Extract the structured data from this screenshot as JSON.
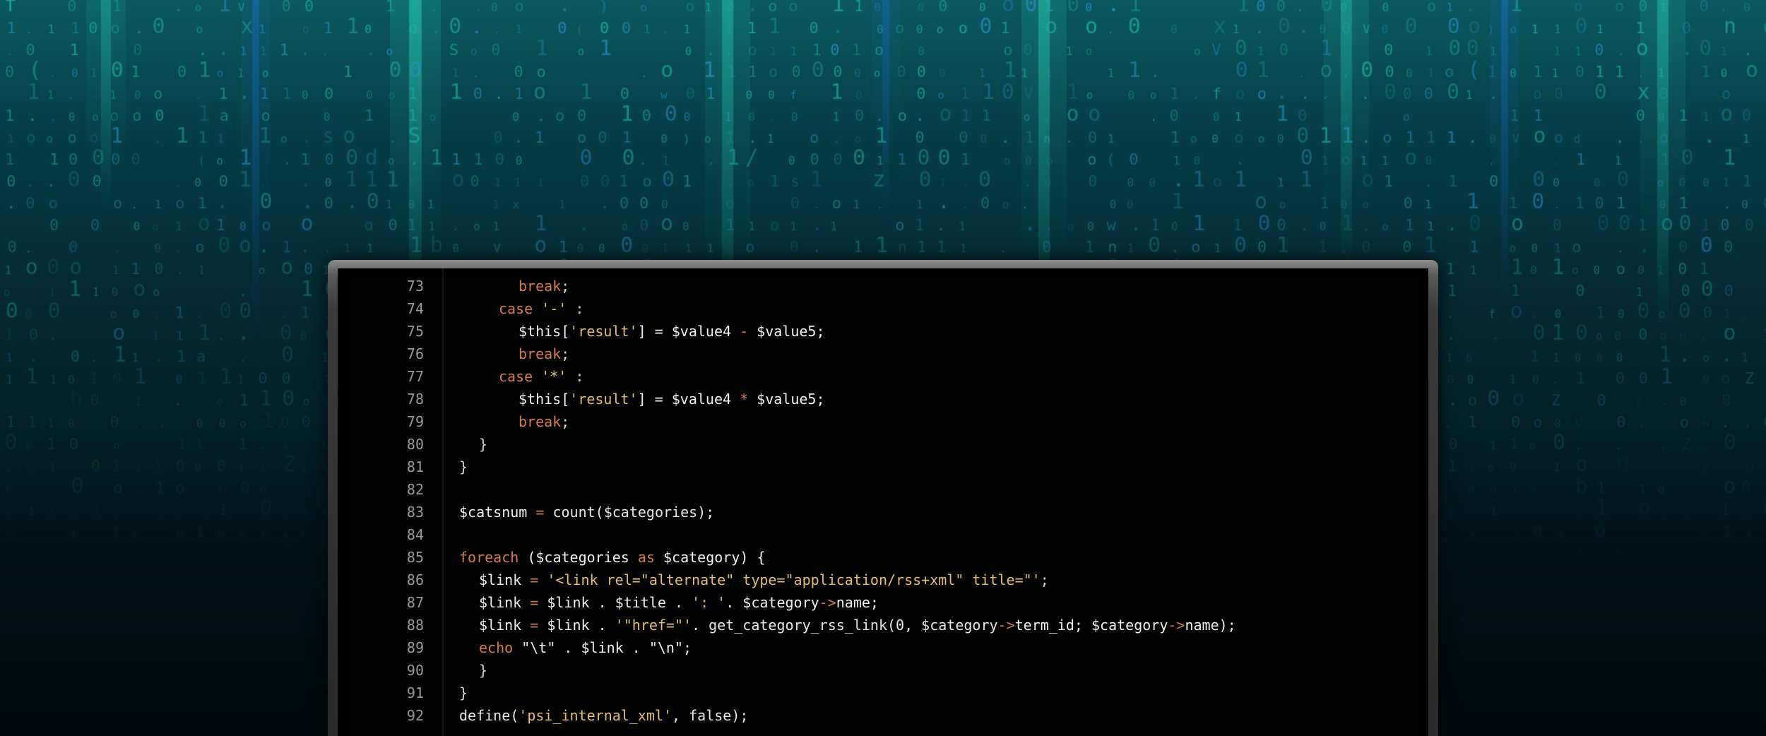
{
  "scene": {
    "background": "matrix-style falling binary code",
    "colors": {
      "teal_glow": "#19c3a6",
      "blue_glow": "#1b7fd6",
      "digit_teal": "#2ab3a8",
      "code_bg": "#020202",
      "line_number": "#9a9a9a",
      "keyword": "#d47c4a",
      "string": "#e2bd72",
      "operator": "#cc7a52",
      "text": "#e6e6e6"
    }
  },
  "editor": {
    "lines": [
      {
        "num": "73",
        "indent": 3,
        "tokens": [
          {
            "t": "break",
            "c": "kw"
          },
          {
            "t": ";",
            "c": "punc"
          }
        ]
      },
      {
        "num": "74",
        "indent": 2,
        "tokens": [
          {
            "t": "case",
            "c": "kw"
          },
          {
            "t": " ",
            "c": "punc"
          },
          {
            "t": "'-'",
            "c": "str"
          },
          {
            "t": " :",
            "c": "punc"
          }
        ]
      },
      {
        "num": "75",
        "indent": 3,
        "tokens": [
          {
            "t": "$this[",
            "c": "var"
          },
          {
            "t": "'result'",
            "c": "str"
          },
          {
            "t": "] = $value4 ",
            "c": "var"
          },
          {
            "t": "-",
            "c": "op"
          },
          {
            "t": " $value5;",
            "c": "var"
          }
        ]
      },
      {
        "num": "76",
        "indent": 3,
        "tokens": [
          {
            "t": "break",
            "c": "kw"
          },
          {
            "t": ";",
            "c": "punc"
          }
        ]
      },
      {
        "num": "77",
        "indent": 2,
        "tokens": [
          {
            "t": "case",
            "c": "kw"
          },
          {
            "t": " ",
            "c": "punc"
          },
          {
            "t": "'*'",
            "c": "str"
          },
          {
            "t": " :",
            "c": "punc"
          }
        ]
      },
      {
        "num": "78",
        "indent": 3,
        "tokens": [
          {
            "t": "$this[",
            "c": "var"
          },
          {
            "t": "'result'",
            "c": "str"
          },
          {
            "t": "] = $value4 ",
            "c": "var"
          },
          {
            "t": "*",
            "c": "op"
          },
          {
            "t": " $value5;",
            "c": "var"
          }
        ]
      },
      {
        "num": "79",
        "indent": 3,
        "tokens": [
          {
            "t": "break",
            "c": "kw"
          },
          {
            "t": ";",
            "c": "punc"
          }
        ]
      },
      {
        "num": "80",
        "indent": 1,
        "tokens": [
          {
            "t": "}",
            "c": "punc"
          }
        ]
      },
      {
        "num": "81",
        "indent": 0,
        "tokens": [
          {
            "t": "}",
            "c": "punc"
          }
        ]
      },
      {
        "num": "82",
        "indent": 0,
        "tokens": []
      },
      {
        "num": "83",
        "indent": 0,
        "tokens": [
          {
            "t": "$catsnum ",
            "c": "var"
          },
          {
            "t": "=",
            "c": "op"
          },
          {
            "t": " count($categories);",
            "c": "fn"
          }
        ]
      },
      {
        "num": "84",
        "indent": 0,
        "tokens": []
      },
      {
        "num": "85",
        "indent": 0,
        "tokens": [
          {
            "t": "foreach",
            "c": "kw"
          },
          {
            "t": " ($categories ",
            "c": "var"
          },
          {
            "t": "as",
            "c": "kw"
          },
          {
            "t": " $category) {",
            "c": "var"
          }
        ]
      },
      {
        "num": "86",
        "indent": 1,
        "tokens": [
          {
            "t": "$link ",
            "c": "var"
          },
          {
            "t": "=",
            "c": "op"
          },
          {
            "t": " ",
            "c": "punc"
          },
          {
            "t": "'<link rel=\"alternate\" type=\"application/rss+xml\" title=\"'",
            "c": "str"
          },
          {
            "t": ";",
            "c": "punc"
          }
        ]
      },
      {
        "num": "87",
        "indent": 1,
        "tokens": [
          {
            "t": "$link ",
            "c": "var"
          },
          {
            "t": "=",
            "c": "op"
          },
          {
            "t": " $link . $title . ",
            "c": "var"
          },
          {
            "t": "': '",
            "c": "str"
          },
          {
            "t": ". $category",
            "c": "var"
          },
          {
            "t": "->",
            "c": "op"
          },
          {
            "t": "name;",
            "c": "var"
          }
        ]
      },
      {
        "num": "88",
        "indent": 1,
        "tokens": [
          {
            "t": "$link ",
            "c": "var"
          },
          {
            "t": "=",
            "c": "op"
          },
          {
            "t": " $link . ",
            "c": "var"
          },
          {
            "t": "'\"href=\"'",
            "c": "str"
          },
          {
            "t": ". get_category_rss_link(0, $category",
            "c": "fn"
          },
          {
            "t": "->",
            "c": "op"
          },
          {
            "t": "term_id; $category",
            "c": "var"
          },
          {
            "t": "->",
            "c": "op"
          },
          {
            "t": "name);",
            "c": "var"
          }
        ]
      },
      {
        "num": "89",
        "indent": 1,
        "tokens": [
          {
            "t": "echo",
            "c": "kw"
          },
          {
            "t": " \"\\t\" . $link . \"\\n\";",
            "c": "var"
          }
        ]
      },
      {
        "num": "90",
        "indent": 1,
        "tokens": [
          {
            "t": "}",
            "c": "punc"
          }
        ]
      },
      {
        "num": "91",
        "indent": 0,
        "tokens": [
          {
            "t": "}",
            "c": "punc"
          }
        ]
      },
      {
        "num": "92",
        "indent": 0,
        "tokens": [
          {
            "t": "define(",
            "c": "fn"
          },
          {
            "t": "'psi_internal_xml'",
            "c": "str"
          },
          {
            "t": ", false);",
            "c": "fn"
          }
        ]
      }
    ]
  }
}
